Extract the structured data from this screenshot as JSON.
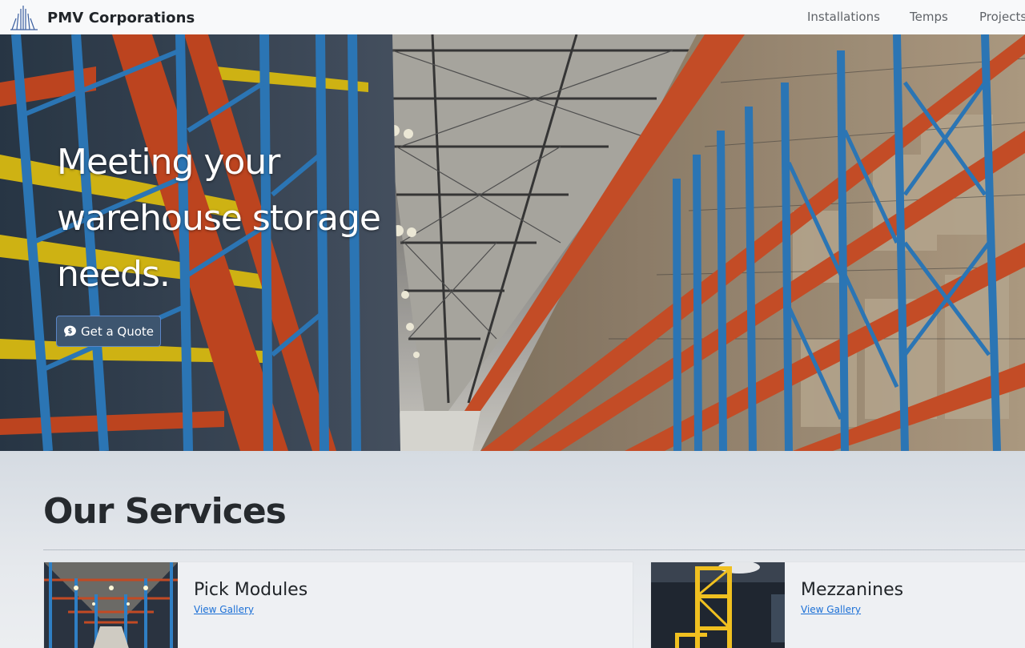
{
  "brand": {
    "name": "PMV Corporations",
    "logo_icon": "building-icon"
  },
  "nav": {
    "items": [
      "Installations",
      "Temps",
      "Projects"
    ]
  },
  "hero": {
    "title": "Meeting your warehouse storage needs.",
    "button_label": "Get a Quote",
    "button_icon": "chat-bubble-icon"
  },
  "services": {
    "title": "Our Services",
    "cards": [
      {
        "title": "Pick Modules",
        "link": "View Gallery"
      },
      {
        "title": "Mezzanines",
        "link": "View Gallery"
      }
    ]
  },
  "colors": {
    "navbar_bg": "#f8f9fa",
    "button_bg": "#3d556f",
    "link": "#1a6fd6",
    "rack_blue": "#2e78b8",
    "rack_orange": "#d0542a"
  }
}
